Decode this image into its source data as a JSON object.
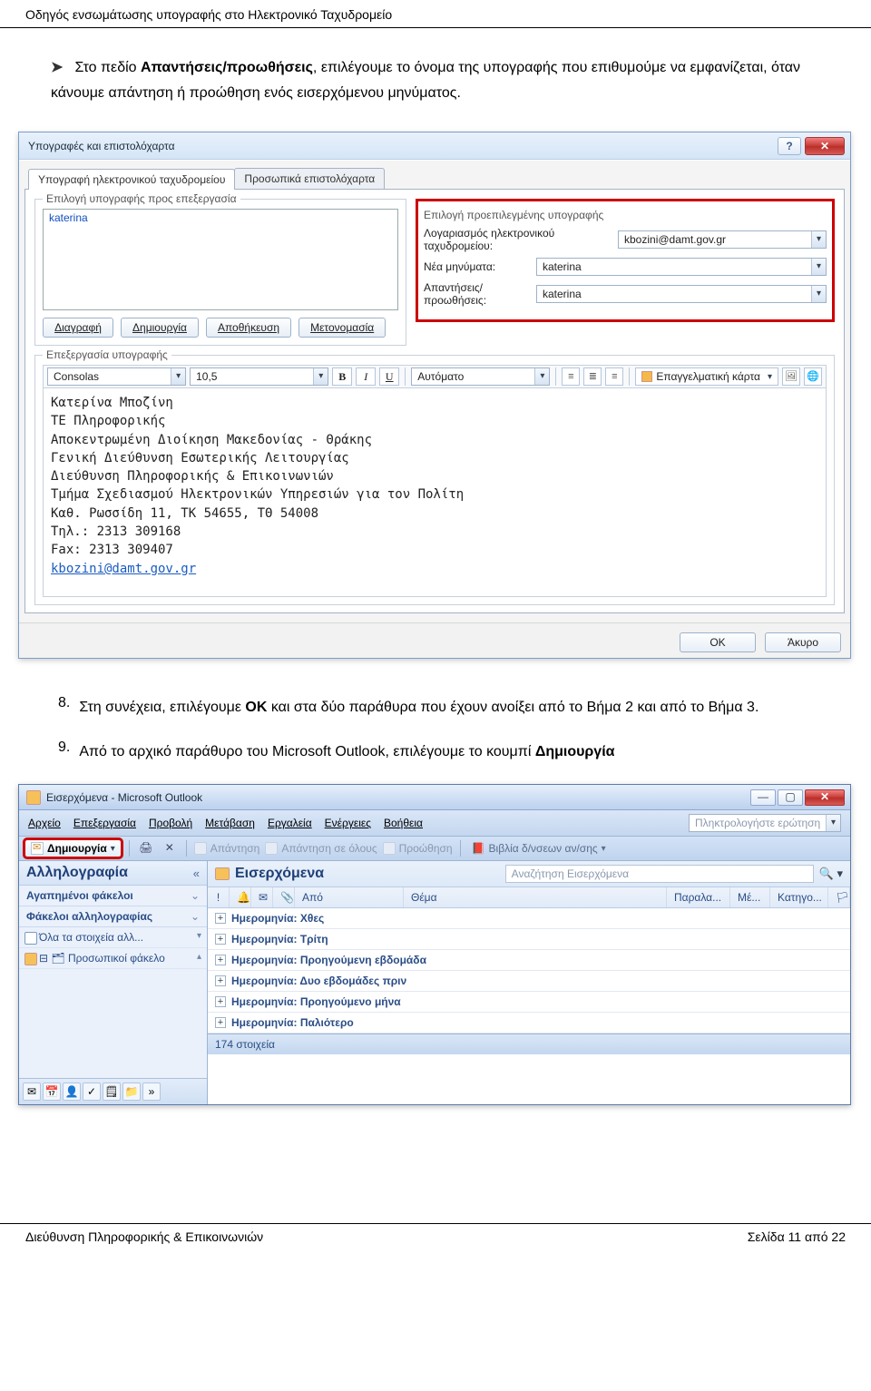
{
  "header": {
    "title": "Οδηγός ενσωμάτωσης υπογραφής στο Ηλεκτρονικό Ταχυδρομείο"
  },
  "bullet": {
    "lead": "Στο πεδίο ",
    "bold": "Απαντήσεις/προωθήσεις",
    "rest": ", επιλέγουμε το όνομα της υπογραφής που επιθυμούμε να εμφανίζεται, όταν κάνουμε απάντηση ή προώθηση ενός εισερχόμενου μηνύματος."
  },
  "dialog_sigs": {
    "title": "Υπογραφές και επιστολόχαρτα",
    "help": "?",
    "close": "✕",
    "tabs": {
      "sig": "Υπογραφή ηλεκτρονικού ταχυδρομείου",
      "stat": "Προσωπικά επιστολόχαρτα"
    },
    "left_legend": "Επιλογή υπογραφής προς επεξεργασία",
    "sig_item": "katerina",
    "right_legend": "Επιλογή προεπιλεγμένης υπογραφής",
    "acct_label": "Λογαριασμός ηλεκτρονικού ταχυδρομείου:",
    "acct_value": "kbozini@damt.gov.gr",
    "new_label": "Νέα μηνύματα:",
    "new_value": "katerina",
    "reply_label": "Απαντήσεις/προωθήσεις:",
    "reply_value": "katerina",
    "btn_delete": "Διαγραφή",
    "btn_new": "Δημιουργία",
    "btn_save": "Αποθήκευση",
    "btn_rename": "Μετονομασία",
    "edit_legend": "Επεξεργασία υπογραφής",
    "font": "Consolas",
    "size": "10,5",
    "color": "Αυτόματο",
    "card": "Επαγγελματική κάρτα",
    "sig_lines": [
      "Κατερίνα Μποζίνη",
      "ΤΕ Πληροφορικής",
      "Αποκεντρωμένη Διοίκηση Μακεδονίας - Θράκης",
      "Γενική Διεύθυνση Εσωτερικής Λειτουργίας",
      "Διεύθυνση Πληροφορικής & Επικοινωνιών",
      "Τμήμα Σχεδιασμού Ηλεκτρονικών Υπηρεσιών για τον Πολίτη",
      "Καθ. Ρωσσίδη 11, ΤΚ 54655, ΤΘ 54008",
      "Τηλ.: 2313 309168",
      "Fax: 2313 309407"
    ],
    "sig_link": "kbozini@damt.gov.gr",
    "ok": "OK",
    "cancel": "Άκυρο"
  },
  "steps": {
    "n8": "8.",
    "t8_a": "Στη συνέχεια, επιλέγουμε ",
    "t8_b": "ΟΚ",
    "t8_c": " και στα δύο παράθυρα που έχουν ανοίξει από το Βήμα 2 και από το Βήμα 3.",
    "n9": "9.",
    "t9_a": "Από το αρχικό παράθυρο του Microsoft Outlook, επιλέγουμε το κουμπί ",
    "t9_b": "Δημιουργία"
  },
  "outlook": {
    "title": "Εισερχόμενα - Microsoft Outlook",
    "menu": [
      "Αρχείο",
      "Επεξεργασία",
      "Προβολή",
      "Μετάβαση",
      "Εργαλεία",
      "Ενέργειες",
      "Βοήθεια"
    ],
    "ask_placeholder": "Πληκτρολογήστε ερώτηση",
    "new_btn": "Δημιουργία",
    "reply": "Απάντηση",
    "reply_all": "Απάντηση σε όλους",
    "forward": "Προώθηση",
    "books": "Βιβλία δ/νσεων αν/σης",
    "nav_title": "Αλληλογραφία",
    "nav_collapse": "«",
    "fav_folders": "Αγαπημένοι φάκελοι",
    "mail_folders": "Φάκελοι αλληλογραφίας",
    "all_items": "Όλα τα στοιχεία αλλ...",
    "personal": "Προσωπικοί φάκελο",
    "list_title": "Εισερχόμενα",
    "search_placeholder": "Αναζήτηση Εισερχόμενα",
    "cols": {
      "from": "Από",
      "subject": "Θέμα",
      "recv": "Παραλα...",
      "size": "Μέ...",
      "cat": "Κατηγο..."
    },
    "groups": [
      "Ημερομηνία: Χθες",
      "Ημερομηνία: Τρίτη",
      "Ημερομηνία: Προηγούμενη εβδομάδα",
      "Ημερομηνία: Δυο εβδομάδες πριν",
      "Ημερομηνία: Προηγούμενο μήνα",
      "Ημερομηνία: Παλιότερο"
    ],
    "status": "174 στοιχεία"
  },
  "footer": {
    "left": "Διεύθυνση Πληροφορικής & Επικοινωνιών",
    "right": "Σελίδα 11 από 22"
  }
}
